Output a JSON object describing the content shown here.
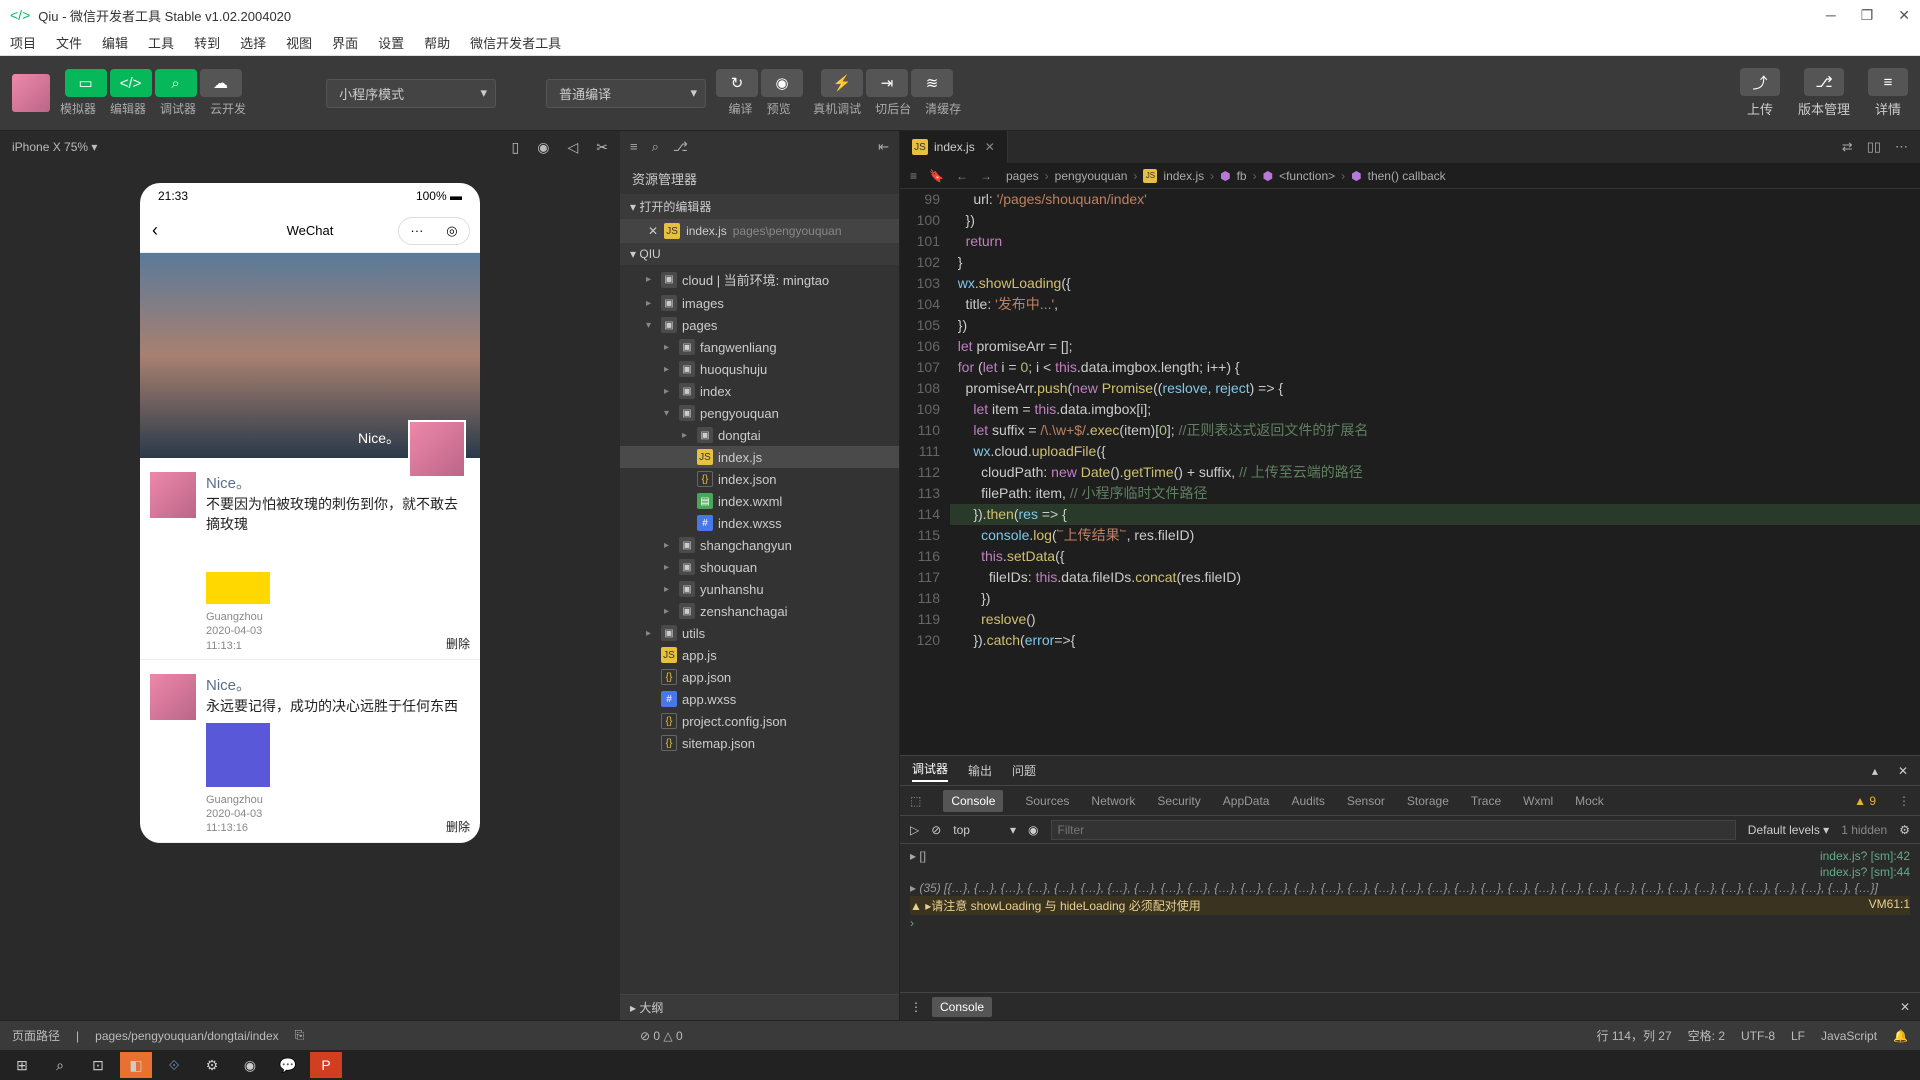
{
  "title": "Qiu - 微信开发者工具 Stable v1.02.2004020",
  "menu": [
    "项目",
    "文件",
    "编辑",
    "工具",
    "转到",
    "选择",
    "视图",
    "界面",
    "设置",
    "帮助",
    "微信开发者工具"
  ],
  "toolbar": {
    "labels": [
      "模拟器",
      "编辑器",
      "调试器",
      "云开发"
    ],
    "mode": "小程序模式",
    "compile": "普通编译",
    "actions": [
      "编译",
      "预览",
      "真机调试",
      "切后台",
      "清缓存"
    ],
    "right": [
      "上传",
      "版本管理",
      "详情"
    ]
  },
  "sim": {
    "device": "iPhone X 75%",
    "time": "21:33",
    "battery": "100%",
    "headtitle": "WeChat",
    "heronice": "Nice。"
  },
  "posts": [
    {
      "name": "Nice。",
      "text": "不要因为怕被玫瑰的刺伤到你，就不敢去摘玫瑰",
      "loc": "Guangzhou",
      "date": "2020-04-03",
      "ts": "11:13:1",
      "del": "删除"
    },
    {
      "name": "Nice。",
      "text": "永远要记得，成功的决心远胜于任何东西",
      "loc": "Guangzhou",
      "date": "2020-04-03",
      "ts": "11:13:16",
      "del": "删除"
    }
  ],
  "explorer": {
    "title": "资源管理器",
    "openedh": "打开的编辑器",
    "opened": {
      "file": "index.js",
      "path": "pages\\pengyouquan"
    },
    "root": "QIU",
    "outline": "大纲",
    "tree": [
      {
        "d": 1,
        "t": "folder",
        "n": "cloud | 当前环境: mingtao",
        "exp": false
      },
      {
        "d": 1,
        "t": "folder",
        "n": "images",
        "exp": false
      },
      {
        "d": 1,
        "t": "folder",
        "n": "pages",
        "exp": true
      },
      {
        "d": 2,
        "t": "folder",
        "n": "fangwenliang",
        "exp": false
      },
      {
        "d": 2,
        "t": "folder",
        "n": "huoqushuju",
        "exp": false
      },
      {
        "d": 2,
        "t": "folder",
        "n": "index",
        "exp": false
      },
      {
        "d": 2,
        "t": "folder",
        "n": "pengyouquan",
        "exp": true
      },
      {
        "d": 3,
        "t": "folder",
        "n": "dongtai",
        "exp": false
      },
      {
        "d": 3,
        "t": "js",
        "n": "index.js",
        "sel": true
      },
      {
        "d": 3,
        "t": "json",
        "n": "index.json"
      },
      {
        "d": 3,
        "t": "wxml",
        "n": "index.wxml"
      },
      {
        "d": 3,
        "t": "wxss",
        "n": "index.wxss"
      },
      {
        "d": 2,
        "t": "folder",
        "n": "shangchangyun",
        "exp": false
      },
      {
        "d": 2,
        "t": "folder",
        "n": "shouquan",
        "exp": false
      },
      {
        "d": 2,
        "t": "folder",
        "n": "yunhanshu",
        "exp": false
      },
      {
        "d": 2,
        "t": "folder",
        "n": "zenshanchagai",
        "exp": false
      },
      {
        "d": 1,
        "t": "folder",
        "n": "utils",
        "exp": false
      },
      {
        "d": 1,
        "t": "js",
        "n": "app.js"
      },
      {
        "d": 1,
        "t": "json",
        "n": "app.json"
      },
      {
        "d": 1,
        "t": "wxss",
        "n": "app.wxss"
      },
      {
        "d": 1,
        "t": "json",
        "n": "project.config.json"
      },
      {
        "d": 1,
        "t": "json",
        "n": "sitemap.json"
      }
    ]
  },
  "editor": {
    "tab": "index.js",
    "crumbs": [
      "pages",
      "pengyouquan",
      "index.js",
      "fb",
      "<function>",
      "then() callback"
    ],
    "startline": 99
  },
  "devtools": {
    "tabs1": [
      "调试器",
      "输出",
      "问题"
    ],
    "tabs2": [
      "Console",
      "Sources",
      "Network",
      "Security",
      "AppData",
      "Audits",
      "Sensor",
      "Storage",
      "Trace",
      "Wxml",
      "Mock"
    ],
    "warn": "▲ 9",
    "top": "top",
    "filter": "Filter",
    "levels": "Default levels ▾",
    "hidden": "1 hidden",
    "log1": "▸ []",
    "src1": "index.js? [sm]:42",
    "src2": "index.js? [sm]:44",
    "log3": "(35) [{…}, {…}, {…}, {…}, {…}, {…}, {…}, {…}, {…}, {…}, {…}, {…}, {…}, {…}, {…}, {…}, {…}, {…}, {…}, {…}, {…}, {…}, {…}, {…}, {…}, {…}, {…}, {…}, {…}, {…}, {…}, {…}, {…}, {…}, {…}]",
    "warnmsg": "▲ ▸请注意 showLoading 与 hideLoading 必须配对使用",
    "warnsrc": "VM61:1",
    "foot": "Console"
  },
  "status": {
    "path_l": "页面路径",
    "path": "pages/pengyouquan/dongtai/index",
    "err": "⊘ 0 △ 0",
    "pos": "行 114，列 27",
    "spaces": "空格: 2",
    "enc": "UTF-8",
    "eol": "LF",
    "lang": "JavaScript"
  }
}
